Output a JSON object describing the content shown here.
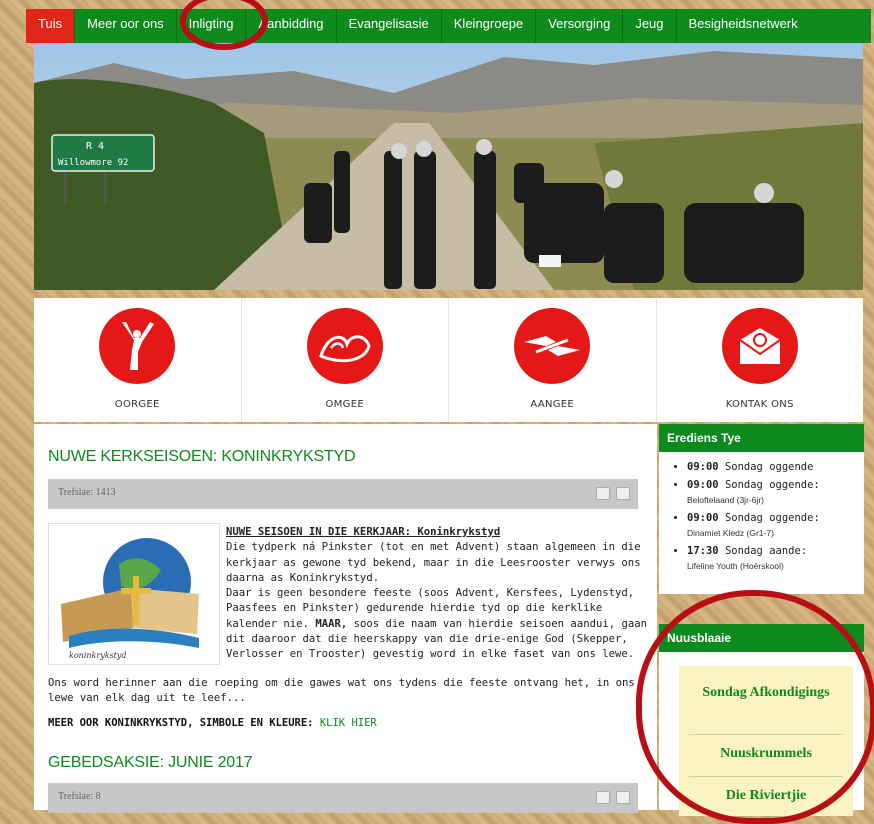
{
  "nav": {
    "items": [
      "Tuis",
      "Meer oor ons",
      "Inligting",
      "Aanbidding",
      "Evangelisasie",
      "Kleingroepe",
      "Versorging",
      "Jeug",
      "Besigheidsnetwerk"
    ],
    "active": "Tuis"
  },
  "hero": {
    "road_sign": {
      "line1": "R 4",
      "line2": "Willowmore 92"
    }
  },
  "icon_strip": [
    {
      "label": "OORGEE",
      "icon": "raised-hands-person-icon"
    },
    {
      "label": "OMGEE",
      "icon": "caring-hands-icon"
    },
    {
      "label": "AANGEE",
      "icon": "passing-hands-icon"
    },
    {
      "label": "KONTAK ONS",
      "icon": "email-envelope-icon"
    }
  ],
  "article": {
    "title": "NUWE KERKSEISOEN: KONINKRYKSTYD",
    "hits": "Trefslae: 1413",
    "heading": "NUWE SEISOEN IN DIE KERKJAAR: Koninkrykstyd",
    "para1": "Die tydperk ná Pinkster (tot en met Advent) staan algemeen in die kerkjaar as gewone tyd bekend, maar in die Leesrooster verwys ons daarna as Koninkrykstyd.",
    "para2": "Daar is geen besondere feeste (soos Advent, Kersfees, Lydenstyd, Paasfees en Pinkster) gedurende hierdie tyd op die kerklike kalender nie.",
    "para2b_bold": "MAAR,",
    "para2b": " soos die naam van hierdie seisoen aandui, gaan dit daaroor dat die heerskappy van die drie-enige God (Skepper, Verlosser en Trooster) gevestig word in elke faset van ons lewe.",
    "para3": "Ons word herinner aan die roeping om die gawes wat ons tydens die feeste ontvang het, in ons lewe van elk dag uit te leef...",
    "more_label": "MEER OOR KONINKRYKSTYD, SIMBOLE EN KLEURE:",
    "more_link": "KLIK HIER",
    "image_caption": "koninkrykstyd"
  },
  "article2": {
    "title": "GEBEDSAKSIE: JUNIE 2017",
    "hits": "Trefslae: 8"
  },
  "sidebar": {
    "services": {
      "title": "Erediens Tye",
      "items": [
        {
          "time": "09:00",
          "text": "Sondag oggende"
        },
        {
          "time": "09:00",
          "text": "Sondag oggende:",
          "sub": "Beloftelaand (3jr-6jr)"
        },
        {
          "time": "09:00",
          "text": "Sondag oggende:",
          "sub": "Dinamiet Kiedz (Gr1-7)"
        },
        {
          "time": "17:30",
          "text": "Sondag aande:",
          "sub": "Lifeline Youth (Hoërskool)"
        }
      ]
    },
    "news": {
      "title": "Nuusblaaie",
      "items": [
        "Sondag Afkondigings",
        "Nuuskrummels",
        "Die Riviertjie"
      ]
    }
  },
  "colors": {
    "green": "#0d8a1e",
    "red": "#e51818",
    "annotation": "#b80f16"
  }
}
